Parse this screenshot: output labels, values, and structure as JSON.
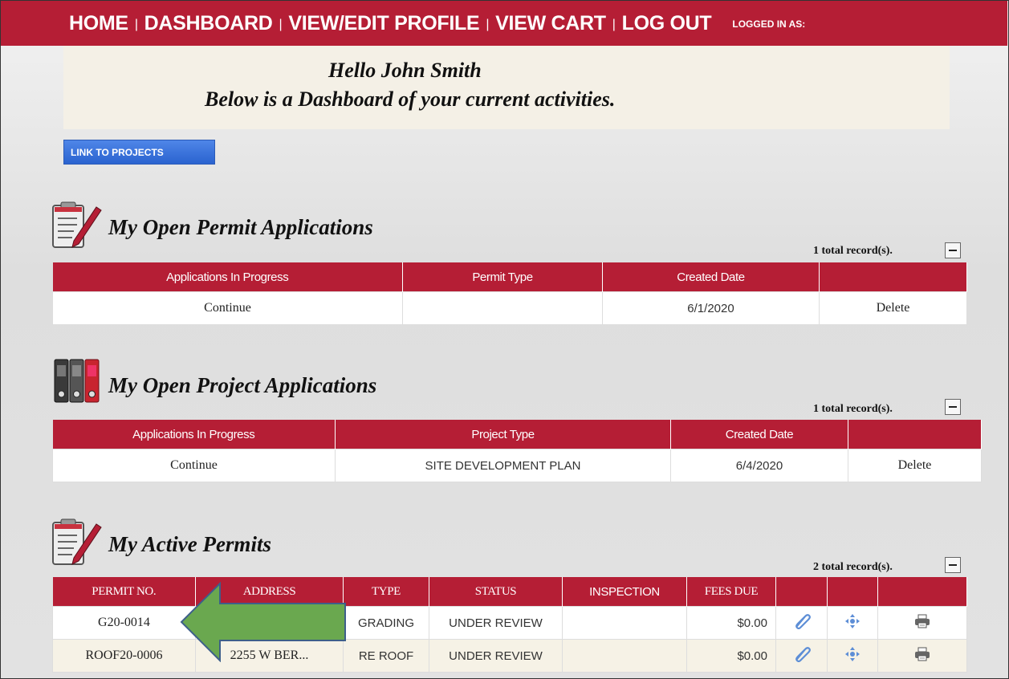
{
  "nav": {
    "home": "HOME",
    "dashboard": "DASHBOARD",
    "profile": "VIEW/EDIT PROFILE",
    "cart": "VIEW CART",
    "logout": "LOG OUT",
    "logged_in": "LOGGED IN AS:",
    "separator": "|"
  },
  "greeting": {
    "line1": "Hello John Smith",
    "line2": "Below is a Dashboard of your current activities."
  },
  "projects_link": "LINK TO PROJECTS",
  "permit_apps": {
    "title": "My Open Permit Applications",
    "count": "1 total record(s).",
    "headers": [
      "Applications In Progress",
      "Permit Type",
      "Created Date",
      ""
    ],
    "rows": [
      {
        "action": "Continue",
        "type": "",
        "date": "6/1/2020",
        "delete": "Delete"
      }
    ]
  },
  "project_apps": {
    "title": "My Open Project Applications",
    "count": "1 total record(s).",
    "headers": [
      "Applications In Progress",
      "Project Type",
      "Created Date",
      ""
    ],
    "rows": [
      {
        "action": "Continue",
        "type": "SITE DEVELOPMENT PLAN",
        "date": "6/4/2020",
        "delete": "Delete"
      }
    ]
  },
  "active_permits": {
    "title": "My Active Permits",
    "count": "2 total record(s).",
    "headers": [
      "PERMIT NO.",
      "ADDRESS",
      "TYPE",
      "STATUS",
      "INSPECTION",
      "FEES DUE",
      "",
      "",
      ""
    ],
    "rows": [
      {
        "permit": "G20-0014",
        "address": "",
        "type": "GRADING",
        "status": "UNDER REVIEW",
        "inspection": "",
        "fees": "$0.00",
        "icons": [
          "paperclip-icon",
          "move-icon",
          "printer-icon"
        ]
      },
      {
        "permit": "ROOF20-0006",
        "address": "2255 W BER...",
        "type": "RE ROOF",
        "status": "UNDER REVIEW",
        "inspection": "",
        "fees": "$0.00",
        "icons": [
          "paperclip-icon",
          "move-icon",
          "printer-icon"
        ]
      }
    ]
  },
  "colors": {
    "brand_red": "#b51e35",
    "greeting_bg": "#f4f0e6",
    "link_blue": "#2a63cf",
    "arrow_green": "#6aa84f"
  }
}
